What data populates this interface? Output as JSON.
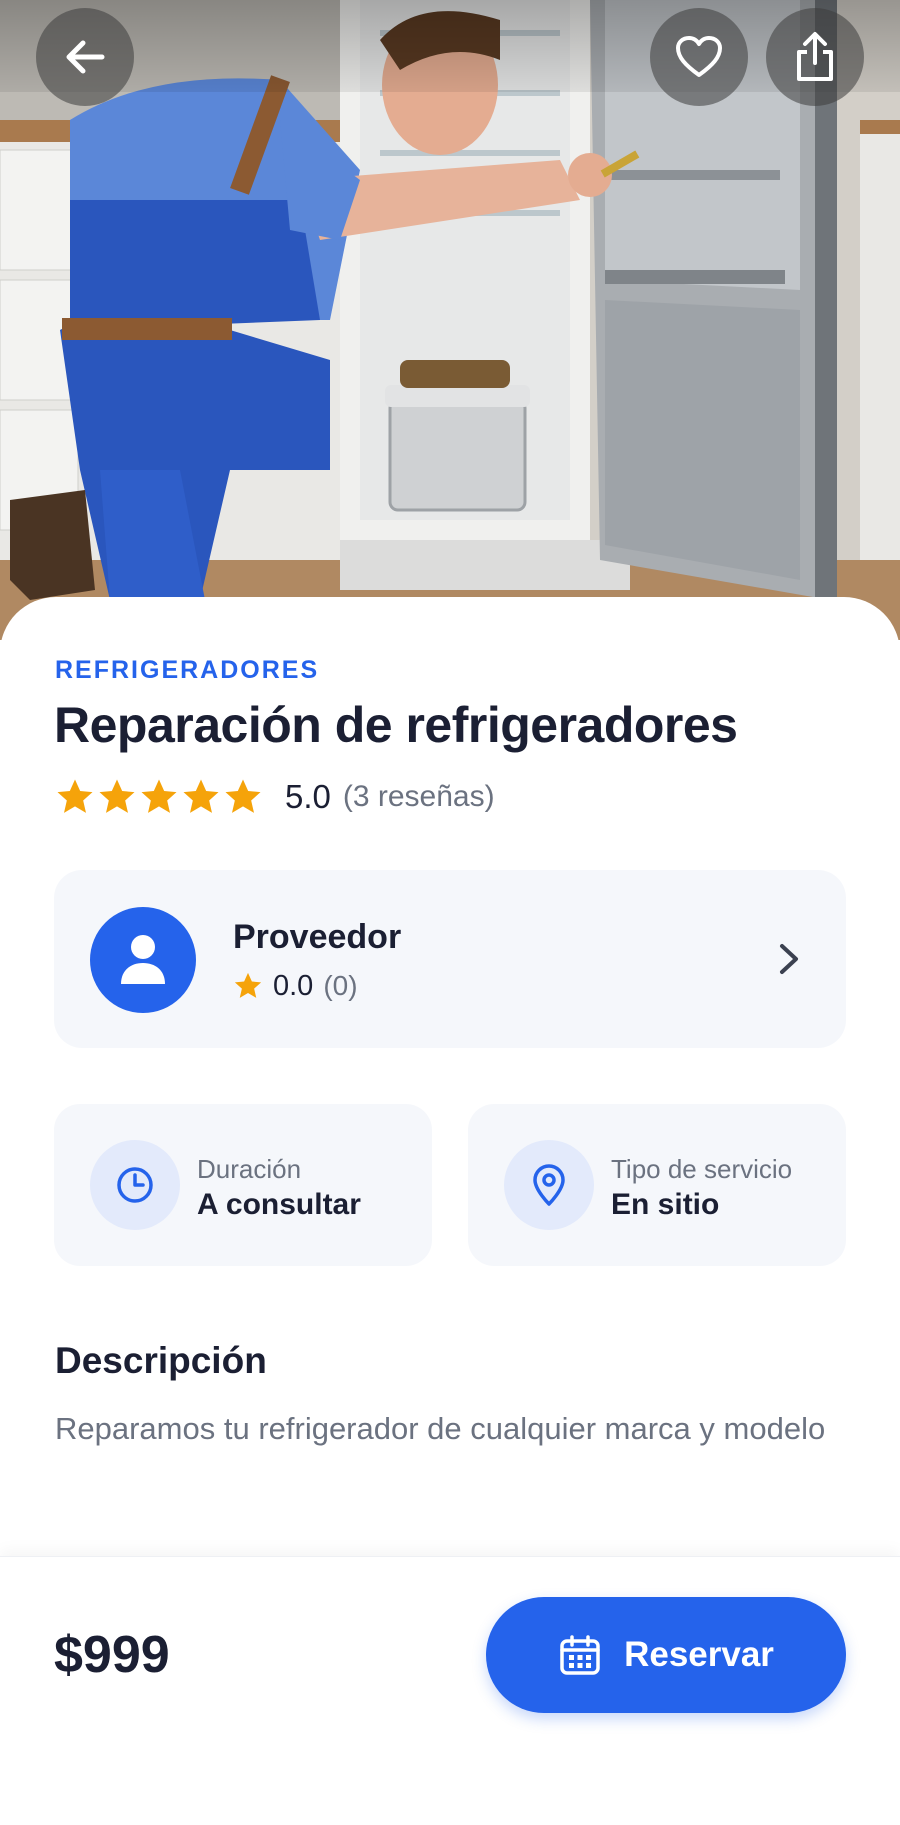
{
  "hero": {
    "image_alt": "Technician repairing a stainless steel refrigerator",
    "back_icon": "arrow-left-icon",
    "favorite_icon": "heart-outline-icon",
    "share_icon": "share-icon"
  },
  "service": {
    "category": "REFRIGERADORES",
    "title": "Reparación de refrigeradores",
    "rating": "5.0",
    "rating_count": "(3 reseñas)",
    "stars": 5
  },
  "provider": {
    "name": "Proveedor",
    "rating": "0.0",
    "rating_count": "(0)",
    "avatar_icon": "user-icon",
    "chevron_icon": "chevron-right-icon"
  },
  "info": {
    "duration": {
      "label": "Duración",
      "value": "A consultar",
      "icon": "clock-icon"
    },
    "service_type": {
      "label": "Tipo de servicio",
      "value": "En sitio",
      "icon": "map-pin-icon"
    }
  },
  "description": {
    "heading": "Descripción",
    "text": "Reparamos tu refrigerador de cualquier marca y modelo"
  },
  "booking": {
    "price": "$999",
    "button_label": "Reservar",
    "button_icon": "calendar-icon"
  },
  "colors": {
    "accent": "#2563eb",
    "star": "#f5a30a",
    "text_primary": "#1b1f33",
    "text_secondary": "#6b7280",
    "card_bg": "#f5f7fb"
  }
}
